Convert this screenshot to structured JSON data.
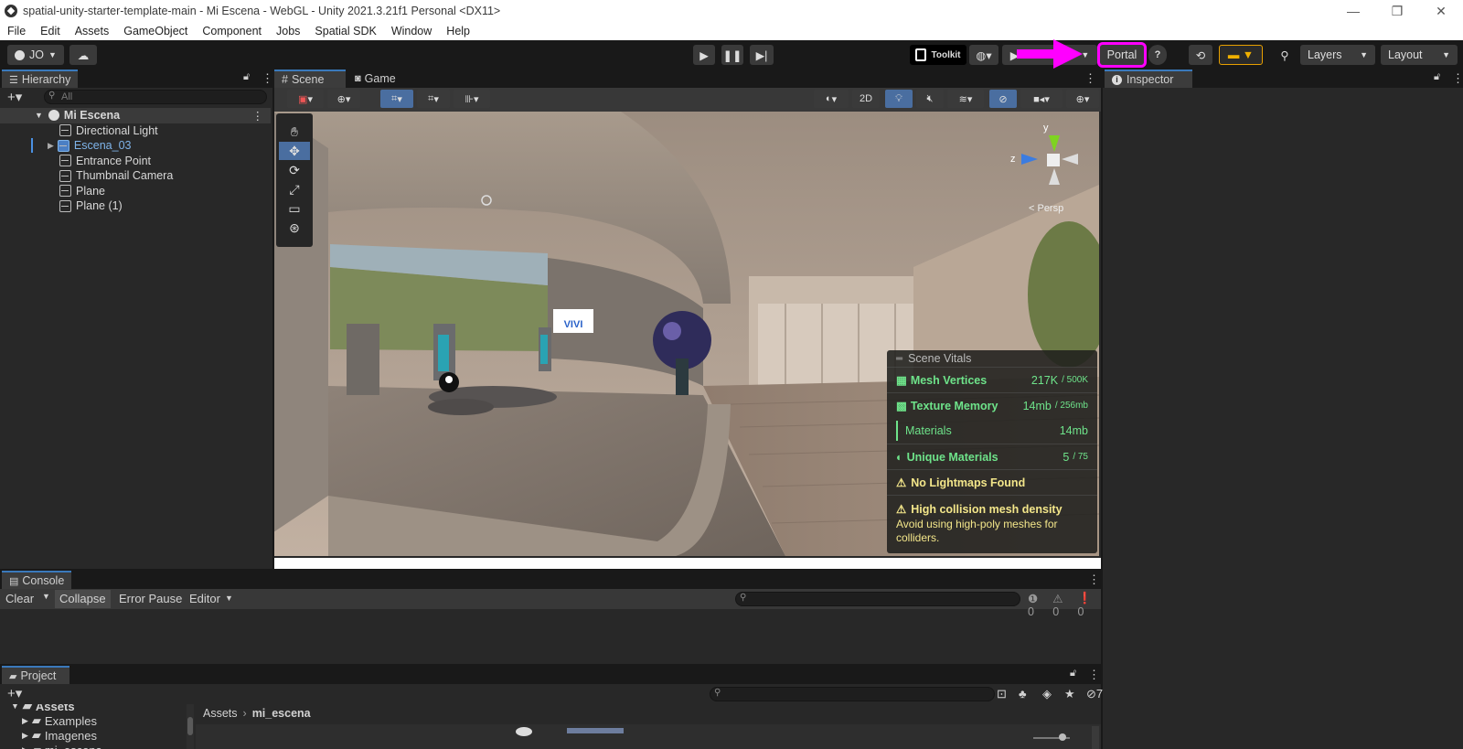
{
  "window": {
    "title": "spatial-unity-starter-template-main - Mi Escena - WebGL - Unity 2021.3.21f1 Personal <DX11>",
    "controls": {
      "minimize": "—",
      "maximize": "❐",
      "close": "✕"
    }
  },
  "menu": [
    "File",
    "Edit",
    "Assets",
    "GameObject",
    "Component",
    "Jobs",
    "Spatial SDK",
    "Window",
    "Help"
  ],
  "toolbar": {
    "account_label": "JO",
    "toolkit_label": "Toolkit",
    "portal_label": "Portal",
    "layers_label": "Layers",
    "layout_label": "Layout",
    "accent_color": "#ff00ff"
  },
  "hierarchy": {
    "tab_label": "Hierarchy",
    "search_placeholder": "All",
    "scene_name": "Mi Escena",
    "items": [
      {
        "label": "Directional Light",
        "selected": false
      },
      {
        "label": "Escena_03",
        "selected": false
      },
      {
        "label": "Entrance Point",
        "selected": false
      },
      {
        "label": "Thumbnail Camera",
        "selected": false
      },
      {
        "label": "Plane",
        "selected": false
      },
      {
        "label": "Plane (1)",
        "selected": false
      }
    ]
  },
  "scene": {
    "tabs": [
      "Scene",
      "Game"
    ],
    "btn_2d": "2D",
    "gizmo": {
      "y": "y",
      "z": "z",
      "persp": "< Persp"
    },
    "sign_text": "VIVI"
  },
  "vitals": {
    "title": "Scene Vitals",
    "mesh_vertices": {
      "label": "Mesh Vertices",
      "value": "217K",
      "max": "/ 500K"
    },
    "texture_memory": {
      "label": "Texture Memory",
      "value": "14mb",
      "max": "/ 256mb"
    },
    "materials": {
      "label": "Materials",
      "value": "14mb"
    },
    "unique_materials": {
      "label": "Unique Materials",
      "value": "5",
      "max": "/ 75"
    },
    "no_lightmaps": "No Lightmaps Found",
    "collision_title": "High collision mesh density",
    "collision_body": "Avoid using high-poly meshes for colliders."
  },
  "inspector": {
    "tab_label": "Inspector"
  },
  "console": {
    "tab_label": "Console",
    "clear": "Clear",
    "collapse": "Collapse",
    "error_pause": "Error Pause",
    "editor": "Editor",
    "counts": {
      "log": "0",
      "warn": "0",
      "error": "0"
    }
  },
  "project": {
    "tab_label": "Project",
    "tree": [
      "Assets",
      "Examples",
      "Imagenes",
      "mi_escena"
    ],
    "breadcrumb_root": "Assets",
    "breadcrumb_current": "mi_escena",
    "hidden_count": "7"
  }
}
